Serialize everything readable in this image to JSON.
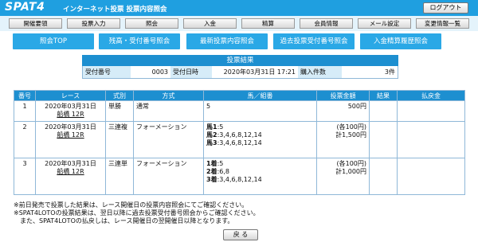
{
  "header": {
    "logo": "SPAT4",
    "title": "インターネット投票 投票内容照会",
    "logout_label": "ログアウト"
  },
  "menu": [
    "開催要領",
    "投票入力",
    "照会",
    "入金",
    "精算",
    "会員情報",
    "メール設定",
    "変更情報一覧"
  ],
  "actions": [
    "照会TOP",
    "残高・受付番号照会",
    "最新投票内容照会",
    "過去投票受付番号照会",
    "入金精算履歴照会"
  ],
  "summary": {
    "title": "投票結果",
    "receipt_no_label": "受付番号",
    "receipt_no": "0003",
    "datetime_label": "受付日時",
    "datetime": "2020年03月31日 17:21",
    "count_label": "購入件数",
    "count": "3件"
  },
  "table": {
    "headers": [
      "番号",
      "レース",
      "式別",
      "方式",
      "馬／組番",
      "投票金額",
      "結果",
      "払戻金"
    ],
    "rows": [
      {
        "num": "1",
        "date": "2020年03月31日",
        "race": "船橋 12R",
        "type": "単勝",
        "method": "通常",
        "combo": [
          {
            "k": "",
            "v": "5"
          }
        ],
        "amount": [
          "500円"
        ]
      },
      {
        "num": "2",
        "date": "2020年03月31日",
        "race": "船橋 12R",
        "type": "三連複",
        "method": "フォーメーション",
        "combo": [
          {
            "k": "馬1",
            "v": ":5"
          },
          {
            "k": "馬2",
            "v": ":3,4,6,8,12,14"
          },
          {
            "k": "馬3",
            "v": ":3,4,6,8,12,14"
          }
        ],
        "amount": [
          "(各100円)",
          "計1,500円"
        ]
      },
      {
        "num": "3",
        "date": "2020年03月31日",
        "race": "船橋 12R",
        "type": "三連単",
        "method": "フォーメーション",
        "combo": [
          {
            "k": "1着",
            "v": ":5"
          },
          {
            "k": "2着",
            "v": ":6,8"
          },
          {
            "k": "3着",
            "v": ":3,4,6,8,12,14"
          }
        ],
        "amount": [
          "(各100円)",
          "計1,000円"
        ]
      }
    ]
  },
  "notes": [
    "※前日発売で投票した結果は、レース開催日の投票内容照会にてご確認ください。",
    "※SPAT4LOTOの投票結果は、翌日以降に過去投票受付番号照会からご確認ください。",
    "　また、SPAT4LOTOの払戻しは、レース開催日の翌開催日以降となります。"
  ],
  "back_label": "戻 る"
}
